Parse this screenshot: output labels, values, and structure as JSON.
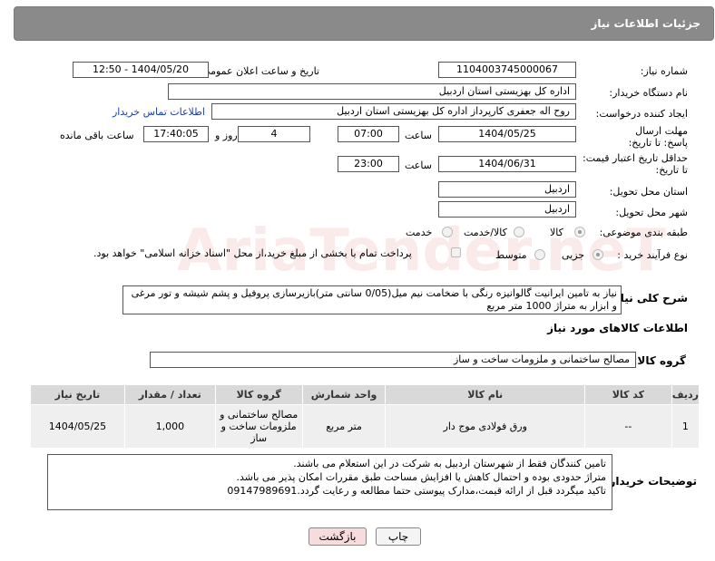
{
  "header": {
    "title": "جزئیات اطلاعات نیاز"
  },
  "fields": {
    "need_number_label": "شماره نیاز:",
    "need_number": "1104003745000067",
    "announce_label": "تاریخ و ساعت اعلان عمومی:",
    "announce_value": "1404/05/20 - 12:50",
    "buyer_org_label": "نام دستگاه خریدار:",
    "buyer_org": "اداره کل بهزیستی استان اردبیل",
    "requester_label": "ایجاد کننده درخواست:",
    "requester": "روح اله جعفری کارپرداز اداره کل بهزیستی استان اردبیل",
    "contact_link": "اطلاعات تماس خریدار",
    "deadline_label": "مهلت ارسال پاسخ: تا تاریخ:",
    "deadline_date": "1404/05/25",
    "time_label": "ساعت",
    "deadline_time": "07:00",
    "days_value": "4",
    "days_label": "روز و",
    "remaining_time": "17:40:05",
    "remaining_label": "ساعت باقی مانده",
    "validity_label": "حداقل تاریخ اعتبار قیمت: تا تاریخ:",
    "validity_date": "1404/06/31",
    "validity_time": "23:00",
    "province_label": "استان محل تحویل:",
    "province": "اردبیل",
    "city_label": "شهر محل تحویل:",
    "city": "اردبیل",
    "category_label": "طبقه بندی موضوعی:",
    "category_options": [
      "کالا",
      "کالا/خدمت",
      "خدمت"
    ],
    "process_label": "نوع فرآیند خرید :",
    "process_options": [
      "جزیی",
      "متوسط"
    ],
    "payment_note": "پرداخت تمام یا بخشی از مبلغ خرید،از محل \"اسناد خزانه اسلامی\" خواهد بود.",
    "summary_label": "شرح کلی نیاز:",
    "summary": "نیاز به تامین ایرانیت گالوانیزه رنگی با ضخامت نیم میل(0/05 سانتی متر)بازیرسازی پروفیل و پشم شیشه و تور مرغی و ابزار به متراژ 1000 متر مربع",
    "goods_info_title": "اطلاعات کالاهای مورد نیاز",
    "group_label": "گروه کالا:",
    "group_value": "مصالح ساختمانی و ملزومات ساخت و ساز",
    "buyer_notes_label": "توضیحات خریدار:",
    "buyer_notes": [
      "تامین کنندگان فقط از شهرستان اردبیل به شرکت در این استعلام می باشند.",
      "متراژ حدودی بوده و احتمال کاهش یا افزایش مساحت  طبق مقررات امکان پذیر می باشد.",
      "تاکید میگردد قبل از ارائه قیمت،مدارک پیوستی حتما مطالعه و رعایت گردد.09147989691"
    ]
  },
  "table": {
    "headers": [
      "ردیف",
      "کد کالا",
      "نام کالا",
      "واحد شمارش",
      "گروه کالا",
      "تعداد / مقدار",
      "تاریخ نیاز"
    ],
    "row": [
      "1",
      "--",
      "ورق فولادی موج دار",
      "متر مربع",
      "مصالح ساختمانی و ملزومات ساخت و ساز",
      "1,000",
      "1404/05/25"
    ]
  },
  "buttons": {
    "print": "چاپ",
    "back": "بازگشت"
  },
  "watermark": "AriaTender.neT"
}
